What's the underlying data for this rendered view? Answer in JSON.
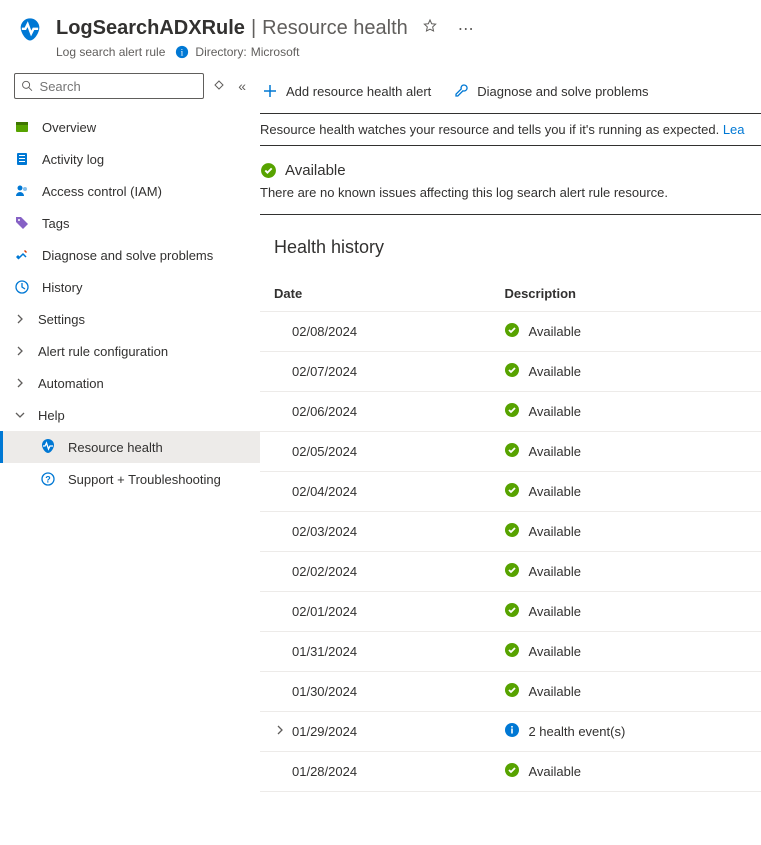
{
  "header": {
    "resource_name": "LogSearchADXRule",
    "blade_title": "Resource health",
    "resource_type": "Log search alert rule",
    "directory_label": "Directory:",
    "directory_value": "Microsoft"
  },
  "search": {
    "placeholder": "Search"
  },
  "nav": {
    "overview": "Overview",
    "activity_log": "Activity log",
    "access_control": "Access control (IAM)",
    "tags": "Tags",
    "diagnose": "Diagnose and solve problems",
    "history": "History",
    "settings": "Settings",
    "alert_rule_config": "Alert rule configuration",
    "automation": "Automation",
    "help": "Help",
    "resource_health": "Resource health",
    "support": "Support + Troubleshooting"
  },
  "toolbar": {
    "add_alert": "Add resource health alert",
    "diagnose": "Diagnose and solve problems"
  },
  "infobar": {
    "text": "Resource health watches your resource and tells you if it's running as expected.",
    "link": "Lea"
  },
  "status": {
    "label": "Available",
    "desc": "There are no known issues affecting this log search alert rule resource."
  },
  "history": {
    "title": "Health history",
    "col_date": "Date",
    "col_desc": "Description",
    "rows": [
      {
        "date": "02/08/2024",
        "kind": "ok",
        "desc": "Available"
      },
      {
        "date": "02/07/2024",
        "kind": "ok",
        "desc": "Available"
      },
      {
        "date": "02/06/2024",
        "kind": "ok",
        "desc": "Available"
      },
      {
        "date": "02/05/2024",
        "kind": "ok",
        "desc": "Available"
      },
      {
        "date": "02/04/2024",
        "kind": "ok",
        "desc": "Available"
      },
      {
        "date": "02/03/2024",
        "kind": "ok",
        "desc": "Available"
      },
      {
        "date": "02/02/2024",
        "kind": "ok",
        "desc": "Available"
      },
      {
        "date": "02/01/2024",
        "kind": "ok",
        "desc": "Available"
      },
      {
        "date": "01/31/2024",
        "kind": "ok",
        "desc": "Available"
      },
      {
        "date": "01/30/2024",
        "kind": "ok",
        "desc": "Available"
      },
      {
        "date": "01/29/2024",
        "kind": "info",
        "desc": "2 health event(s)",
        "expandable": true
      },
      {
        "date": "01/28/2024",
        "kind": "ok",
        "desc": "Available"
      }
    ]
  }
}
